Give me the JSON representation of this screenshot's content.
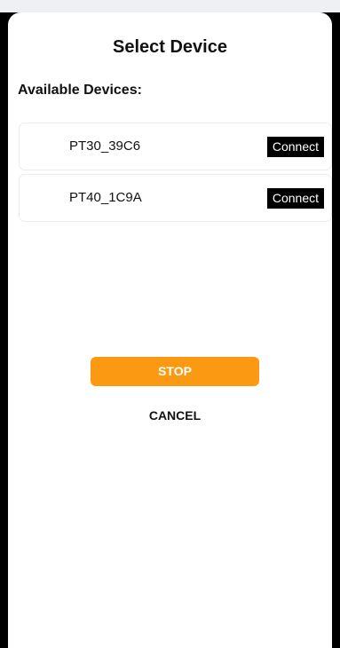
{
  "header": {
    "title": "Select Device"
  },
  "devices": {
    "section_label": "Available Devices:",
    "items": [
      {
        "name": "PT30_39C6",
        "action_label": "Connect"
      },
      {
        "name": "PT40_1C9A",
        "action_label": "Connect"
      }
    ]
  },
  "actions": {
    "stop_label": "STOP",
    "cancel_label": "CANCEL"
  },
  "colors": {
    "accent": "#fb9a12",
    "connect_button": "#000000",
    "frame": "#000000"
  }
}
